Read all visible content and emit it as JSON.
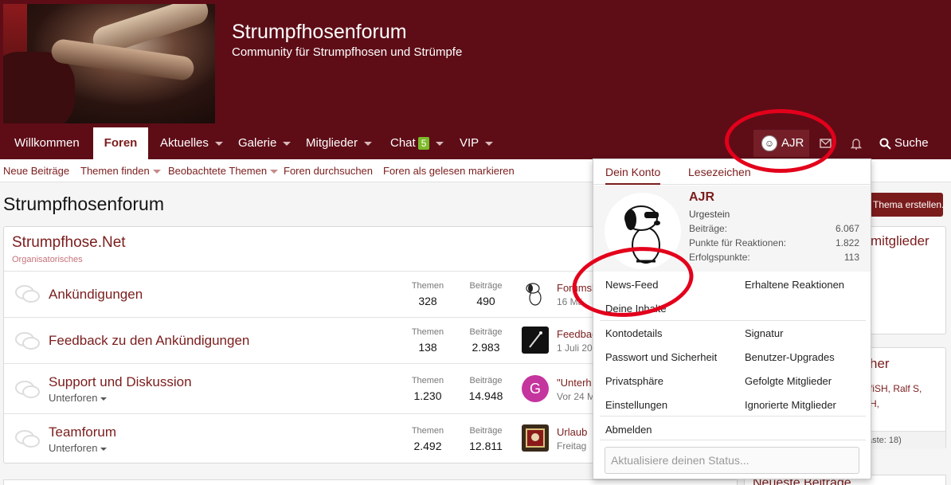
{
  "header": {
    "title": "Strumpfhosenforum",
    "subtitle": "Community für Strumpfhosen und Strümpfe"
  },
  "nav": {
    "items": [
      "Willkommen",
      "Foren",
      "Aktuelles",
      "Galerie",
      "Mitglieder",
      "Chat",
      "VIP"
    ],
    "chat_badge": "5",
    "user": "AJR",
    "search": "Suche"
  },
  "subnav": [
    "Neue Beiträge",
    "Themen finden",
    "Beobachtete Themen",
    "Foren durchsuchen",
    "Foren als gelesen markieren"
  ],
  "page": {
    "title": "Strumpfhosenforum",
    "new_thread_button": "Thema erstellen..."
  },
  "category": {
    "title": "Strumpfhose.Net",
    "description": "Organisatorisches"
  },
  "stat_labels": {
    "threads": "Themen",
    "posts": "Beiträge"
  },
  "forums": [
    {
      "name": "Ankündigungen",
      "sub": "",
      "threads": "328",
      "posts": "490",
      "last_title": "Forumsb",
      "last_date": "16 Mä"
    },
    {
      "name": "Feedback zu den Ankündigungen",
      "sub": "",
      "threads": "138",
      "posts": "2.983",
      "last_title": "Feedbac",
      "last_date": "1 Juli 20"
    },
    {
      "name": "Support und Diskussion",
      "sub": "Unterforen",
      "threads": "1.230",
      "posts": "14.948",
      "last_title": "\"Unterh",
      "last_date": "Vor 24 M",
      "avatar_letter": "G"
    },
    {
      "name": "Teamforum",
      "sub": "Unterforen",
      "threads": "2.492",
      "posts": "12.811",
      "last_title": "Urlaub",
      "last_date": "Freitag"
    }
  ],
  "sidebar": {
    "box1_title": "mitglieder",
    "box2_title": "her",
    "box2_members1": "fiSH, Ralf S,",
    "box2_members2": "H,",
    "box2_footer": "äste: 18)",
    "box3_title": "Neueste Beiträge"
  },
  "menu": {
    "tabs": [
      "Dein Konto",
      "Lesezeichen"
    ],
    "username": "AJR",
    "rank": "Urgestein",
    "stats": [
      {
        "label": "Beiträge:",
        "value": "6.067"
      },
      {
        "label": "Punkte für Reaktionen:",
        "value": "1.822"
      },
      {
        "label": "Erfolgspunkte:",
        "value": "113"
      }
    ],
    "links_left": [
      "News-Feed",
      "Deine Inhalte"
    ],
    "links_right": [
      "Erhaltene Reaktionen"
    ],
    "account_left": [
      "Kontodetails",
      "Passwort und Sicherheit",
      "Privatsphäre",
      "Einstellungen"
    ],
    "account_right": [
      "Signatur",
      "Benutzer-Upgrades",
      "Gefolgte Mitglieder",
      "Ignorierte Mitglieder"
    ],
    "logout": "Abmelden",
    "status_placeholder": "Aktualisiere deinen Status..."
  },
  "colors": {
    "brand": "#5e0d17",
    "accent": "#7b1c1c",
    "annotation": "#e3001b"
  }
}
